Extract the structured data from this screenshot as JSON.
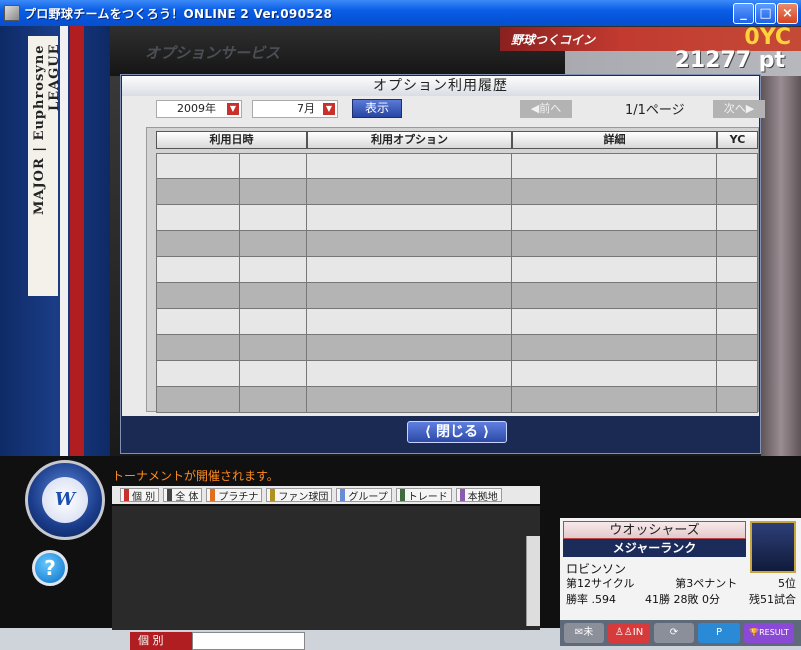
{
  "window": {
    "title": "プロ野球チームをつくろう！ONLINE 2 Ver.090528",
    "minimize": "_",
    "maximize": "□",
    "close": "×"
  },
  "side": {
    "league": "MAJOR | Euphrosyne LEAGUE"
  },
  "header": {
    "section": "オプションサービス",
    "coin_label": "野球つくコイン",
    "coin_value": "0YC",
    "points_value": "21277 pt"
  },
  "dialog": {
    "title": "オプション利用履歴",
    "year_select": "2009年",
    "month_select": "7月",
    "show_button": "表示",
    "prev_button": "前へ",
    "page_info": "1/1ページ",
    "next_button": "次へ",
    "columns": [
      "利用日時",
      "利用オプション",
      "詳細",
      "YC"
    ],
    "row_count": 10,
    "close_button": "閉じる"
  },
  "chat": {
    "ticker": "トーナメントが開催されます。",
    "tabs": [
      {
        "label": "個 別",
        "color": "#c8302b"
      },
      {
        "label": "全 体",
        "color": "#444444"
      },
      {
        "label": "プラチナ",
        "color": "#e07020"
      },
      {
        "label": "ファン球団",
        "color": "#b09020"
      },
      {
        "label": "グループ",
        "color": "#6a8ad6"
      },
      {
        "label": "トレード",
        "color": "#406a40"
      },
      {
        "label": "本拠地",
        "color": "#8a5ab0"
      }
    ],
    "target": "個 別"
  },
  "team": {
    "name": "ウオッシャーズ",
    "rank": "メジャーランク",
    "manager": "ロビンソン",
    "cycle": "第12サイクル",
    "pennant": "第3ペナント",
    "position": "5位",
    "win_rate": "勝率 .594",
    "wins_losses": "41勝 28敗 0分",
    "remaining": "残51試合"
  },
  "actions": {
    "mail": "未",
    "in": "IN",
    "p": "P",
    "result": "RESULT"
  }
}
